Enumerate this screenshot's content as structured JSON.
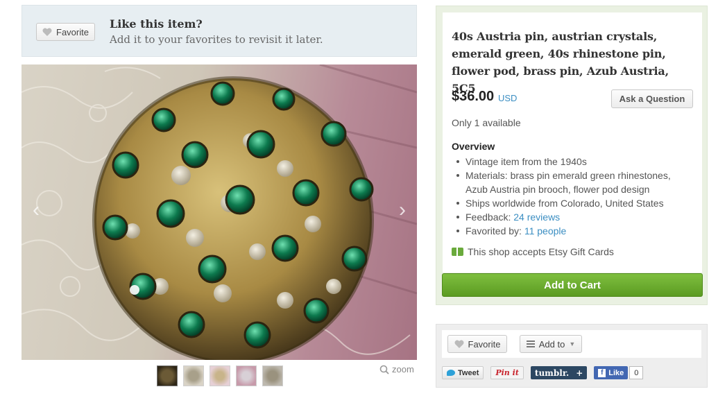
{
  "favorite_bar": {
    "button_label": "Favorite",
    "title": "Like this item?",
    "subtitle": "Add it to your favorites to revisit it later."
  },
  "image": {
    "prev_icon": "chevron-left-icon",
    "next_icon": "chevron-right-icon",
    "zoom_label": "zoom",
    "thumbnails": 5
  },
  "listing": {
    "title": "40s Austria pin, austrian crystals, emerald green, 40s rhinestone pin, flower pod, brass pin, Azub Austria, 5C5",
    "price": "$36.00",
    "currency": "USD",
    "ask_button": "Ask a Question",
    "availability": "Only 1 available",
    "overview_heading": "Overview",
    "overview": {
      "item1": "Vintage item from the 1940s",
      "item2": "Materials: brass pin emerald green rhinestones, Azub Austria pin brooch, flower pod design",
      "item3": "Ships worldwide from Colorado, United States",
      "feedback_label": "Feedback: ",
      "feedback_link": "24 reviews",
      "favorited_label": "Favorited by: ",
      "favorited_link": "11 people"
    },
    "gift_cards": "This shop accepts Etsy Gift Cards",
    "add_to_cart": "Add to Cart"
  },
  "social": {
    "favorite_label": "Favorite",
    "add_to_label": "Add to",
    "tweet": "Tweet",
    "pinit": "Pin it",
    "tumblr": "tumblr.",
    "tumblr_plus": "+",
    "like": "Like",
    "like_count": "0"
  },
  "colors": {
    "accent_link": "#3b8ec2",
    "cart_green": "#6aaa30",
    "fav_bar_bg": "#e7eef2"
  }
}
